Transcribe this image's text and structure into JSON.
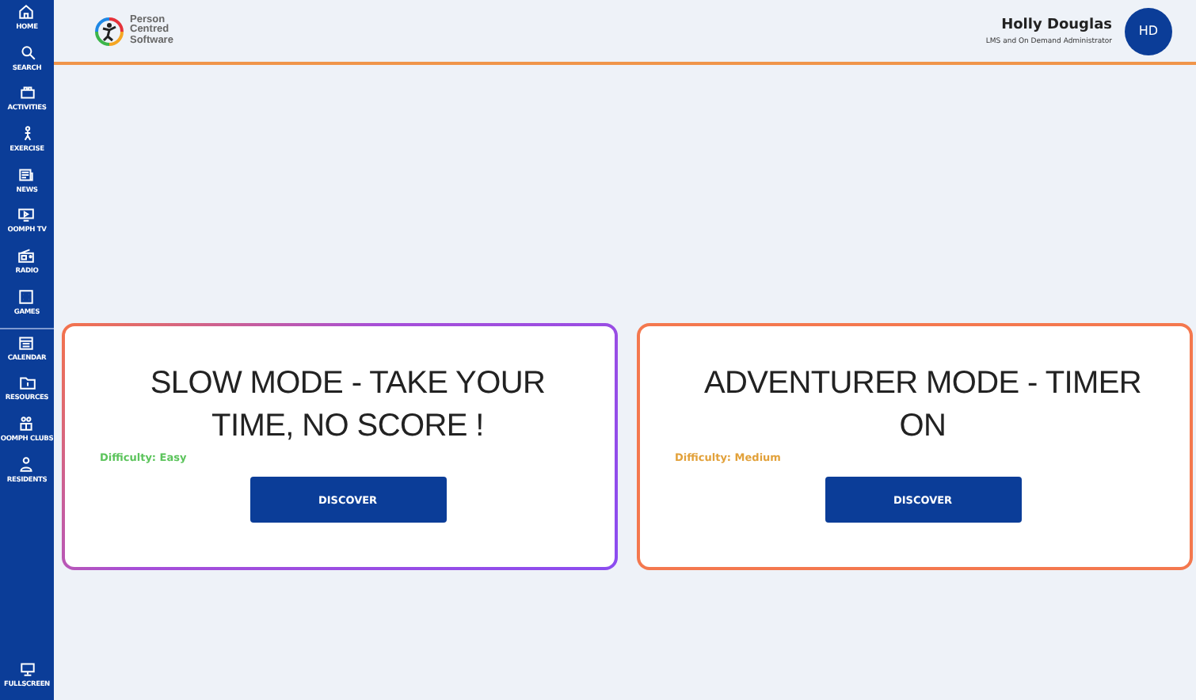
{
  "sidebar": {
    "sections": [
      {
        "items": [
          {
            "label": "HOME"
          },
          {
            "label": "SEARCH"
          },
          {
            "label": "ACTIVITIES"
          },
          {
            "label": "EXERCISE"
          },
          {
            "label": "NEWS"
          },
          {
            "label": "OOMPH TV"
          },
          {
            "label": "RADIO"
          },
          {
            "label": "GAMES"
          }
        ]
      },
      {
        "items": [
          {
            "label": "CALENDAR"
          },
          {
            "label": "RESOURCES"
          },
          {
            "label": "OOMPH CLUBS"
          },
          {
            "label": "RESIDENTS"
          }
        ]
      }
    ],
    "bottom_item": {
      "label": "FULLSCREEN"
    }
  },
  "header": {
    "logo_text": [
      "Person",
      "Centred",
      "Software"
    ],
    "user": {
      "name": "Holly Douglas",
      "role": "LMS and On Demand Administrator",
      "initials": "HD"
    }
  },
  "cards": [
    {
      "kind": "gradient",
      "title": "SLOW MODE - TAKE YOUR TIME, NO SCORE !",
      "difficulty": "Difficulty: Easy",
      "color": "#5cc45c",
      "button": "DISCOVER"
    },
    {
      "kind": "solid",
      "title": "ADVENTURER MODE - TIMER ON",
      "difficulty": "Difficulty: Medium",
      "color": "#e2a13a",
      "button": "DISCOVER"
    }
  ]
}
